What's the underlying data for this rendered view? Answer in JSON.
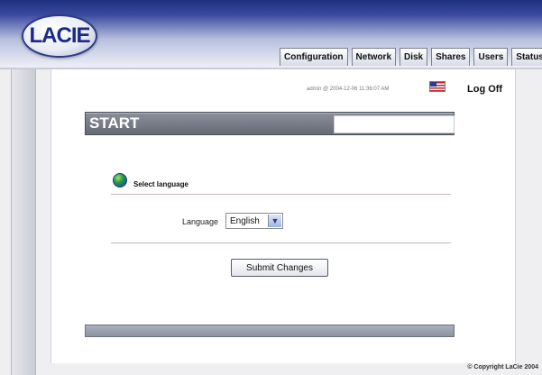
{
  "header": {
    "logo_text": "LACIE",
    "tabs": [
      {
        "label": "Configuration"
      },
      {
        "label": "Network"
      },
      {
        "label": "Disk"
      },
      {
        "label": "Shares"
      },
      {
        "label": "Users"
      },
      {
        "label": "Status"
      }
    ]
  },
  "session": {
    "info": "admin @ 2004-12-06 11:36:07 AM",
    "flag_icon": "us-flag-icon",
    "logoff_label": "Log Off"
  },
  "page": {
    "title": "START",
    "section_title": "Select language",
    "section_icon": "globe-icon"
  },
  "form": {
    "language_label": "Language",
    "language_value": "English",
    "submit_label": "Submit Changes"
  },
  "footer": {
    "copyright": "© Copyright LaCie 2004"
  },
  "colors": {
    "header_dark": "#1f2f80",
    "title_bar": "#767b86",
    "divider": "#cdb3b8"
  }
}
